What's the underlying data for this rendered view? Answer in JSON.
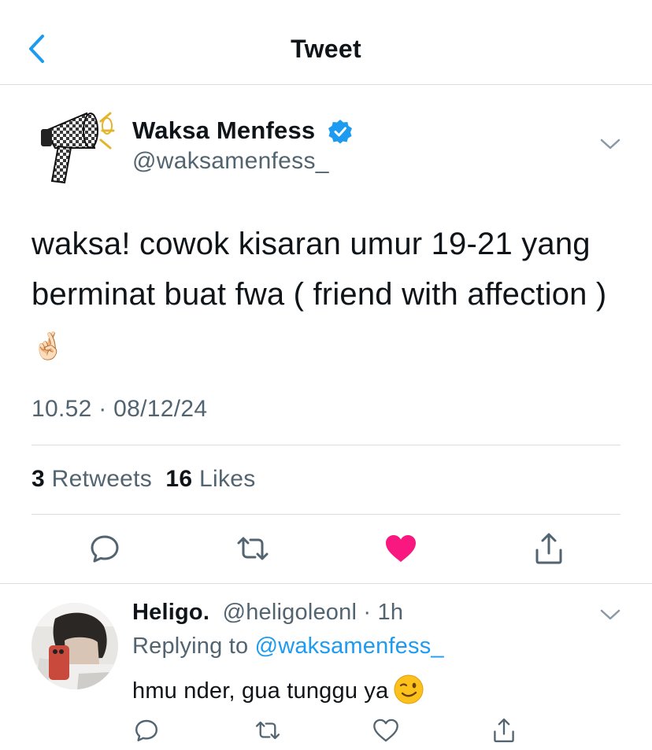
{
  "header": {
    "title": "Tweet",
    "back_icon": "chevron-left-icon"
  },
  "colors": {
    "accent": "#1d9bf0",
    "like": "#f91880",
    "muted": "#536471",
    "text": "#0f1419",
    "divider": "#d9dde1"
  },
  "tweet": {
    "author_name": "Waksa Menfess",
    "author_handle": "@waksamenfess_",
    "verified": true,
    "text": "waksa! cowok kisaran umur 19-21 yang berminat buat fwa ( friend with affection )",
    "text_emoji": "🤞🏻",
    "timestamp": "10.52 · 08/12/24",
    "stats": {
      "retweets_count": "3",
      "retweets_label": "Retweets",
      "likes_count": "16",
      "likes_label": "Likes"
    },
    "actions": [
      "reply-icon",
      "retweet-icon",
      "heart-filled-icon",
      "share-icon"
    ],
    "liked": true
  },
  "reply": {
    "author_name": "Heligo.",
    "author_handle": "@heligoleonl",
    "time": "1h",
    "replying_prefix": "Replying to",
    "replying_to": "@waksamenfess_",
    "text": "hmu nder, gua tunggu ya",
    "text_emoji": "winking-face-emoji",
    "actions": [
      "reply-icon",
      "retweet-icon",
      "heart-outline-icon",
      "share-icon"
    ]
  }
}
